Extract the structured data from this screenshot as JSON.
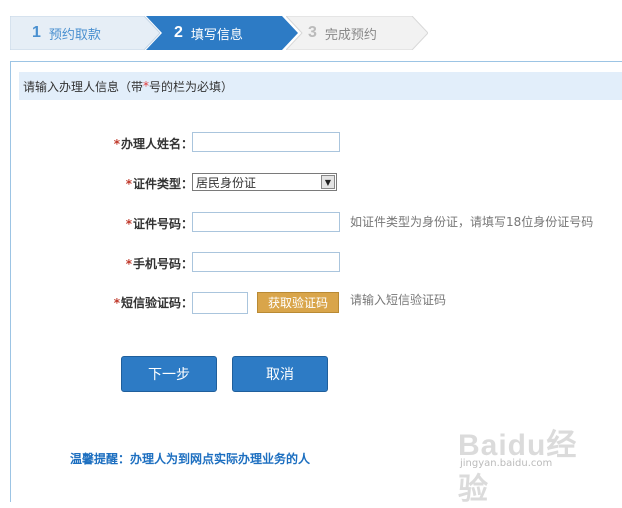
{
  "steps": [
    {
      "num": "1",
      "label": "预约取款"
    },
    {
      "num": "2",
      "label": "填写信息"
    },
    {
      "num": "3",
      "label": "完成预约"
    }
  ],
  "panel": {
    "header_pre": "请输入办理人信息（带",
    "header_star": "*",
    "header_post": "号的栏为必填）"
  },
  "form": {
    "required_mark": "*",
    "name_label": "办理人姓名：",
    "name_value": "",
    "idtype_label": "证件类型：",
    "idtype_selected": "居民身份证",
    "idnum_label": "证件号码：",
    "idnum_value": "",
    "idnum_hint": "如证件类型为身份证，请填写18位身份证号码",
    "phone_label": "手机号码：",
    "phone_value": "",
    "sms_label": "短信验证码：",
    "sms_value": "",
    "sms_button": "获取验证码",
    "sms_hint": "请输入短信验证码"
  },
  "buttons": {
    "next": "下一步",
    "cancel": "取消"
  },
  "notice": "温馨提醒：办理人为到网点实际办理业务的人",
  "watermark": {
    "logo": "Baidu经验",
    "url": "jingyan.baidu.com"
  },
  "colors": {
    "step_active": "#2d7bc5",
    "primary_button": "#2d7bc5",
    "sms_button": "#d9a54a",
    "required": "#c0392b"
  }
}
